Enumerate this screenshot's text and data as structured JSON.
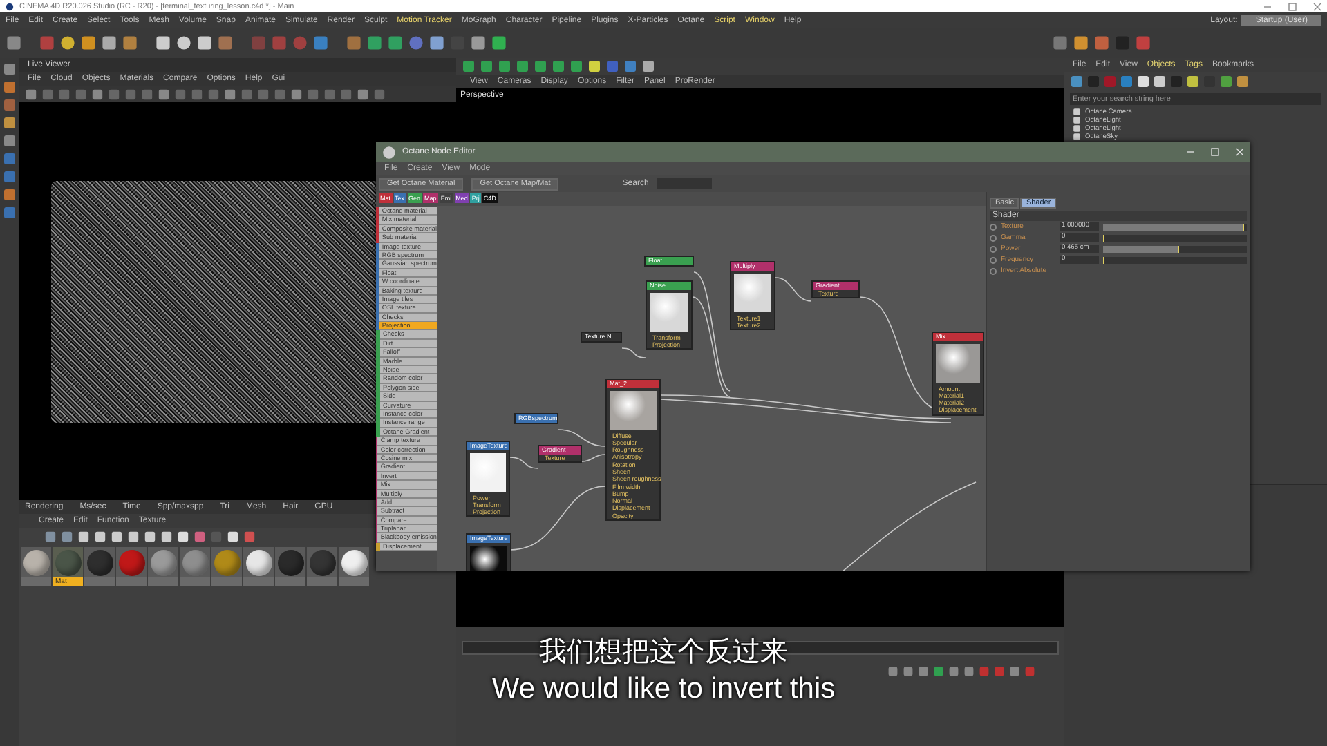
{
  "window": {
    "title": "CINEMA 4D R20.026 Studio (RC - R20) - [terminal_texturing_lesson.c4d *] - Main"
  },
  "menu": [
    "File",
    "Edit",
    "Create",
    "Select",
    "Tools",
    "Mesh",
    "Volume",
    "Snap",
    "Animate",
    "Simulate",
    "Render",
    "Sculpt",
    "Motion Tracker",
    "MoGraph",
    "Character",
    "Pipeline",
    "Plugins",
    "X-Particles",
    "Octane",
    "Script",
    "Window",
    "Help"
  ],
  "layout": {
    "label": "Layout:",
    "value": "Startup (User)"
  },
  "live_viewer": {
    "title": "Live Viewer",
    "menu": [
      "File",
      "Cloud",
      "Objects",
      "Materials",
      "Compare",
      "Options",
      "Help",
      "Gui"
    ],
    "status": [
      "Rendering",
      "Ms/sec",
      "Time",
      "Spp/maxspp",
      "Tri",
      "Mesh",
      "Hair",
      "GPU"
    ]
  },
  "material_manager": {
    "menu": [
      "Create",
      "Edit",
      "Function",
      "Texture"
    ],
    "materials": [
      {
        "color": "#b8b2aa",
        "selected": false
      },
      {
        "color": "#4a5548",
        "selected": true,
        "label": "Mat"
      },
      {
        "color": "#2e2e2e",
        "selected": false
      },
      {
        "color": "#c01818",
        "selected": false
      },
      {
        "color": "#9a9a9a",
        "selected": false
      },
      {
        "color": "#8e8e8e",
        "selected": false
      },
      {
        "color": "#b08a18",
        "selected": false
      },
      {
        "color": "#e6e6e6",
        "selected": false
      },
      {
        "color": "#2a2a2a",
        "selected": false
      },
      {
        "color": "#343434",
        "selected": false
      },
      {
        "color": "#efefef",
        "selected": false
      }
    ]
  },
  "viewport": {
    "menu": [
      "View",
      "Cameras",
      "Display",
      "Options",
      "Filter",
      "Panel",
      "ProRender"
    ],
    "label": "Perspective"
  },
  "object_manager": {
    "menu": [
      "File",
      "Edit",
      "View",
      "Objects",
      "Tags",
      "Bookmarks"
    ],
    "search": {
      "placeholder": "Enter your search string here"
    },
    "objects": [
      "Octane Camera",
      "OctaneLight",
      "OctaneLight",
      "OctaneSky"
    ]
  },
  "node_editor": {
    "title": "Octane Node Editor",
    "menu": [
      "File",
      "Create",
      "View",
      "Mode"
    ],
    "buttons": [
      "Get Octane Material",
      "Get Octane Map/Mat"
    ],
    "search_label": "Search",
    "chips": [
      {
        "label": "Mat",
        "color": "#c0303a"
      },
      {
        "label": "Tex",
        "color": "#3a70b0"
      },
      {
        "label": "Gen",
        "color": "#3aa050"
      },
      {
        "label": "Map",
        "color": "#b0306a"
      },
      {
        "label": "Emi",
        "color": "#404040"
      },
      {
        "label": "Med",
        "color": "#8040b0"
      },
      {
        "label": "Prj",
        "color": "#30a0a0"
      },
      {
        "label": "C4D",
        "color": "#101010"
      }
    ],
    "groups": [
      {
        "color": "#c0303a",
        "items": [
          {
            "label": "Octane material",
            "selected": false
          },
          {
            "label": "Mix material",
            "selected": false
          },
          {
            "label": "Composite material",
            "selected": false
          },
          {
            "label": "Sub material",
            "selected": false
          }
        ]
      },
      {
        "color": "#3a70b0",
        "items": [
          {
            "label": "Image texture",
            "selected": false
          },
          {
            "label": "RGB spectrum",
            "selected": false
          },
          {
            "label": "Gaussian spectrum",
            "selected": false
          },
          {
            "label": "Float",
            "selected": false
          },
          {
            "label": "W coordinate",
            "selected": false
          },
          {
            "label": "Baking texture",
            "selected": false
          },
          {
            "label": "Image tiles",
            "selected": false
          },
          {
            "label": "OSL texture",
            "selected": false
          },
          {
            "label": "Checks",
            "selected": false
          },
          {
            "label": "Projection",
            "selected": true
          }
        ]
      },
      {
        "color": "#3aa050",
        "items": [
          {
            "label": "Checks",
            "selected": false
          },
          {
            "label": "Dirt",
            "selected": false
          },
          {
            "label": "Falloff",
            "selected": false
          },
          {
            "label": "Marble",
            "selected": false
          },
          {
            "label": "Noise",
            "selected": false
          },
          {
            "label": "Random color",
            "selected": false
          },
          {
            "label": "Polygon side",
            "selected": false
          },
          {
            "label": "Side",
            "selected": false
          },
          {
            "label": "Curvature",
            "selected": false
          },
          {
            "label": "Instance color",
            "selected": false
          },
          {
            "label": "Instance range",
            "selected": false
          },
          {
            "label": "Octane Gradient",
            "selected": false
          }
        ]
      },
      {
        "color": "#b0306a",
        "items": [
          {
            "label": "Clamp texture",
            "selected": false
          },
          {
            "label": "Color correction",
            "selected": false
          },
          {
            "label": "Cosine mix",
            "selected": false
          },
          {
            "label": "Gradient",
            "selected": false
          },
          {
            "label": "Invert",
            "selected": false
          },
          {
            "label": "Mix",
            "selected": false
          },
          {
            "label": "Multiply",
            "selected": false
          },
          {
            "label": "Add",
            "selected": false
          },
          {
            "label": "Subtract",
            "selected": false
          },
          {
            "label": "Compare",
            "selected": false
          },
          {
            "label": "Triplanar",
            "selected": false
          },
          {
            "label": "Blackbody emission",
            "selected": false
          }
        ]
      },
      {
        "color": "#c8a030",
        "items": [
          {
            "label": "Displacement",
            "selected": false
          }
        ]
      }
    ],
    "nodes": [
      {
        "kind": "value",
        "title": "Float",
        "color": "#3aa050"
      },
      {
        "kind": "preview",
        "title": "Noise",
        "color": "#3aa050",
        "ports": [
          "Transform",
          "Projection"
        ]
      },
      {
        "kind": "preview",
        "title": "Multiply",
        "color": "#b0306a",
        "ports": [
          "Texture1",
          "Texture2"
        ]
      },
      {
        "kind": "value",
        "title": "Gradient",
        "color": "#b0306a",
        "ports": [
          "Texture"
        ]
      },
      {
        "kind": "value",
        "title": "Texture N",
        "color": "#333333"
      },
      {
        "kind": "preview",
        "title": "Mat_2",
        "color": "#c0303a",
        "ports": [
          "Diffuse",
          "Specular",
          "Roughness",
          "Anisotropy",
          "Rotation",
          "Sheen",
          "Sheen roughness",
          "Film width",
          "Bump",
          "Normal",
          "Displacement",
          "Opacity"
        ]
      },
      {
        "kind": "value",
        "title": "RGBspectrum",
        "color": "#3a70b0"
      },
      {
        "kind": "preview",
        "title": "ImageTexture",
        "color": "#3a70b0",
        "ports": [
          "Power",
          "Transform",
          "Projection"
        ]
      },
      {
        "kind": "value",
        "title": "Gradient",
        "color": "#b0306a",
        "ports": [
          "Texture"
        ]
      },
      {
        "kind": "preview",
        "title": "ImageTexture",
        "color": "#3a70b0"
      },
      {
        "kind": "preview",
        "title": "Mix",
        "color": "#c0303a",
        "ports": [
          "Amount",
          "Material1",
          "Material2",
          "Displacement"
        ]
      }
    ],
    "panel": {
      "tabs": [
        {
          "label": "Basic",
          "selected": false
        },
        {
          "label": "Shader",
          "selected": true
        }
      ],
      "section": "Shader",
      "params": [
        {
          "label": "Texture",
          "value": "1.000000",
          "level": 0.98
        },
        {
          "label": "Gamma",
          "value": "0",
          "level": 0.0
        },
        {
          "label": "Power",
          "value": "0.465 cm",
          "level": 0.53
        },
        {
          "label": "Frequency",
          "value": "0",
          "level": 0.0
        }
      ],
      "option": {
        "label": "Invert Absolute",
        "checked": false
      }
    }
  },
  "subtitles": [
    "我们想把这个反过来",
    "We would like to invert this"
  ]
}
